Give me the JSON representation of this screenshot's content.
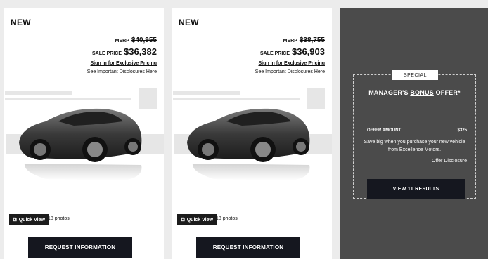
{
  "listings": [
    {
      "badge": "NEW",
      "msrp_label": "MSRP",
      "msrp_value": "$40,955",
      "sale_label": "SALE PRICE",
      "sale_value": "$36,382",
      "signin_text": "Sign in for Exclusive Pricing",
      "disclosures_text": "See Important Disclosures Here",
      "quick_view_label": "Quick View",
      "photos_text": "18 photos",
      "request_label": "REQUEST INFORMATION"
    },
    {
      "badge": "NEW",
      "msrp_label": "MSRP",
      "msrp_value": "$38,755",
      "sale_label": "SALE PRICE",
      "sale_value": "$36,903",
      "signin_text": "Sign in for Exclusive Pricing",
      "disclosures_text": "See Important Disclosures Here",
      "quick_view_label": "Quick View",
      "photos_text": "18 photos",
      "request_label": "REQUEST INFORMATION"
    }
  ],
  "promo": {
    "tag": "SPECIAL",
    "title_prefix": "MANAGER'S ",
    "title_underlined": "BONUS",
    "title_suffix": " OFFER*",
    "offer_amount_label": "OFFER AMOUNT",
    "offer_amount_value": "$325",
    "description": "Save big when you purchase your new vehicle from Excellence Motors.",
    "offer_disclosure": "Offer Disclosure",
    "view_results_label": "VIEW 11 RESULTS"
  },
  "icons": {
    "quick_view": "external-link-icon",
    "car_image": "sports-car-image"
  },
  "colors": {
    "dark_button": "#15171f",
    "promo_bg": "#4b4b4b"
  }
}
